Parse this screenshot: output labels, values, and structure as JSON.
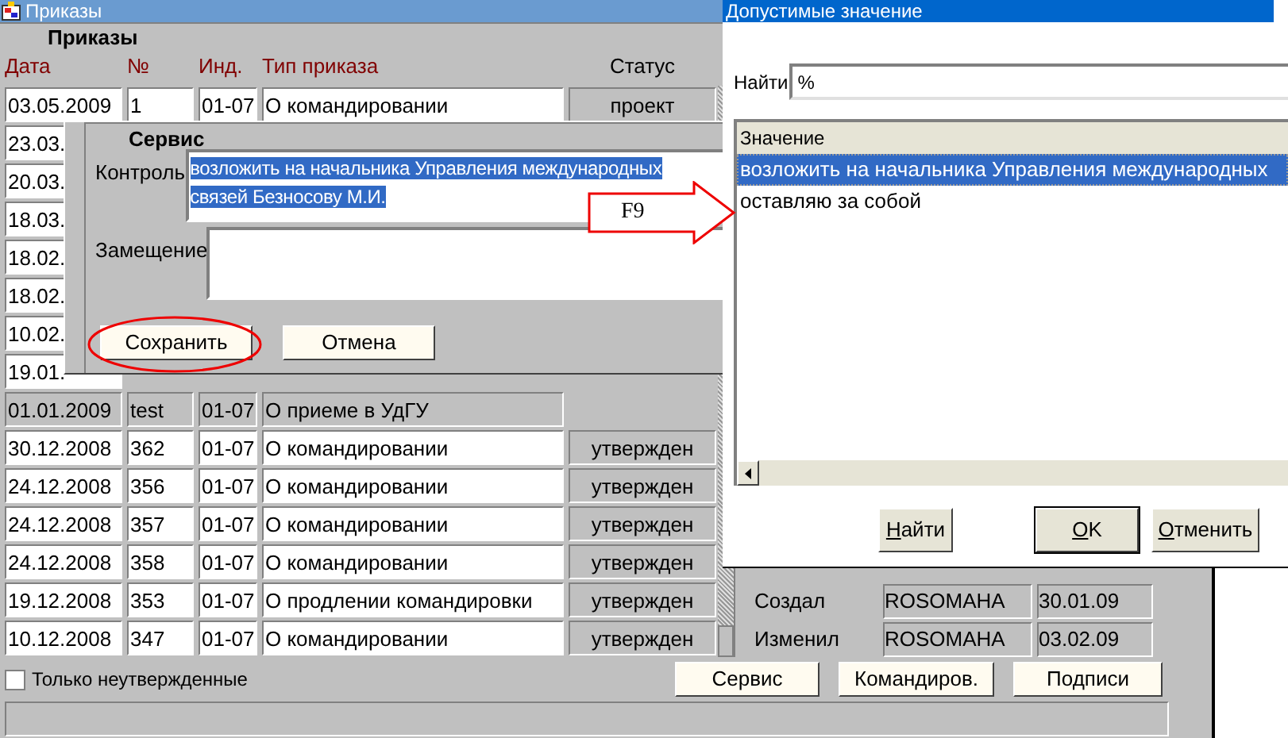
{
  "main_window": {
    "title": "Приказы",
    "heading": "Приказы",
    "columns": [
      {
        "label": "Дата",
        "color": "#800000"
      },
      {
        "label": "№",
        "color": "#800000"
      },
      {
        "label": "Инд.",
        "color": "#800000"
      },
      {
        "label": "Тип приказа",
        "color": "#800000"
      },
      {
        "label": "Статус",
        "color": "#000000"
      }
    ],
    "rows": [
      {
        "cells": [
          "03.05.2009",
          "1",
          "01-07",
          "О командировании",
          "проект"
        ],
        "shaded": false
      },
      {
        "cells": [
          "23.03."
        ],
        "shaded": false
      },
      {
        "cells": [
          "20.03."
        ],
        "shaded": false
      },
      {
        "cells": [
          "18.03."
        ],
        "shaded": false
      },
      {
        "cells": [
          "18.02."
        ],
        "shaded": false
      },
      {
        "cells": [
          "18.02."
        ],
        "shaded": false
      },
      {
        "cells": [
          "10.02."
        ],
        "shaded": false
      },
      {
        "cells": [
          "19.01."
        ],
        "shaded": false
      },
      {
        "cells": [
          "01.01.2009",
          "test",
          "01-07",
          "О приеме в УдГУ"
        ],
        "shaded": true
      },
      {
        "cells": [
          "30.12.2008",
          "362",
          "01-07",
          "О командировании",
          "утвержден"
        ],
        "shaded": false
      },
      {
        "cells": [
          "24.12.2008",
          "356",
          "01-07",
          "О командировании",
          "утвержден"
        ],
        "shaded": false
      },
      {
        "cells": [
          "24.12.2008",
          "357",
          "01-07",
          "О командировании",
          "утвержден"
        ],
        "shaded": false
      },
      {
        "cells": [
          "24.12.2008",
          "358",
          "01-07",
          "О командировании",
          "утвержден"
        ],
        "shaded": false
      },
      {
        "cells": [
          "19.12.2008",
          "353",
          "01-07",
          "О продлении командировки",
          "утвержден"
        ],
        "shaded": false
      },
      {
        "cells": [
          "10.12.2008",
          "347",
          "01-07",
          "О командировании",
          "утвержден"
        ],
        "shaded": false
      }
    ],
    "audit": [
      {
        "label": "Создал",
        "user": "ROSOMAHA",
        "date": "30.01.09"
      },
      {
        "label": "Изменил",
        "user": "ROSOMAHA",
        "date": "03.02.09"
      }
    ],
    "only_unapproved": {
      "label": "Только неутвержденные",
      "checked": false
    },
    "buttons": [
      "Сервис",
      "Командиров.",
      "Подписи"
    ]
  },
  "service_dialog": {
    "title": "Сервис",
    "fields": [
      {
        "label": "Контроль",
        "value": "возложить на начальника Управления международных связей Безносову М.И.",
        "selected": true
      },
      {
        "label": "Замещение"
      }
    ],
    "buttons": [
      {
        "label": "Сохранить",
        "circled": true
      },
      {
        "label": "Отмена",
        "circled": false
      }
    ],
    "callout": "F9"
  },
  "lov_dialog": {
    "title": "Допустимые значение",
    "search": {
      "label": "Найти",
      "value": "%"
    },
    "column": "Значение",
    "items": [
      {
        "text": "возложить на начальника Управления международных",
        "selected": true
      },
      {
        "text": "оставляю за собой",
        "selected": false
      }
    ],
    "buttons": [
      {
        "label": "Найти",
        "mnemonic": true
      },
      {
        "label": "OK",
        "mnemonic": true
      },
      {
        "label": "Отменить",
        "mnemonic": true
      }
    ]
  }
}
